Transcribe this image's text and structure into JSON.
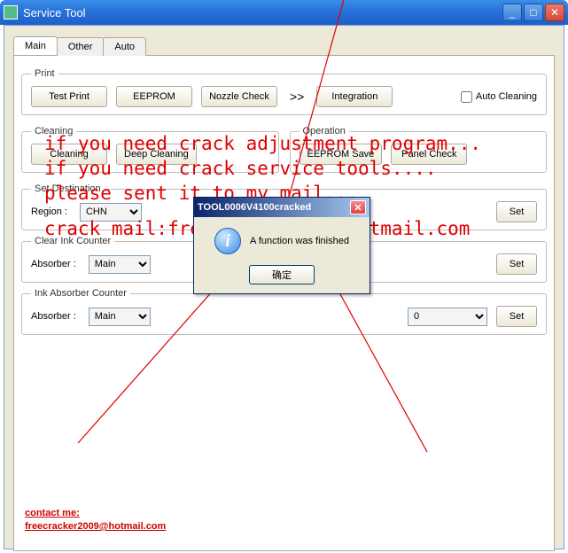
{
  "window": {
    "title": "Service Tool"
  },
  "tabs": {
    "main": "Main",
    "other": "Other",
    "auto": "Auto"
  },
  "print": {
    "legend": "Print",
    "test_print": "Test Print",
    "eeprom": "EEPROM",
    "nozzle": "Nozzle Check",
    "more": ">>",
    "integration": "Integration",
    "auto_cleaning": "Auto Cleaning"
  },
  "cleaning": {
    "legend": "Cleaning",
    "cleaning": "Cleaning",
    "deep": "Deep Cleaning"
  },
  "operation": {
    "legend": "Operation",
    "save": "EEPROM Save",
    "panel": "Panel Check"
  },
  "dest": {
    "legend": "Set Destination",
    "region_label": "Region :",
    "region_value": "CHN",
    "set": "Set"
  },
  "clear_ink": {
    "legend": "Clear Ink Counter",
    "absorber_label": "Absorber :",
    "absorber_value": "Main",
    "set": "Set"
  },
  "ink_abs": {
    "legend": "Ink Absorber Counter",
    "absorber_label": "Absorber :",
    "absorber_value": "Main",
    "counter_value": "0",
    "set": "Set"
  },
  "dialog": {
    "title": "TOOL0006V4100cracked",
    "message": "A function was finished",
    "ok": "确定"
  },
  "overlay": {
    "l1": "if you need crack adjustment program...",
    "l2": "if you need crack service tools....",
    "l3": "please sent it to my mail...",
    "l4": "crack mail:freecracker2009@hotmail.com",
    "contact1": "contact me:",
    "contact2": "freecracker2009@hotmail.com"
  }
}
